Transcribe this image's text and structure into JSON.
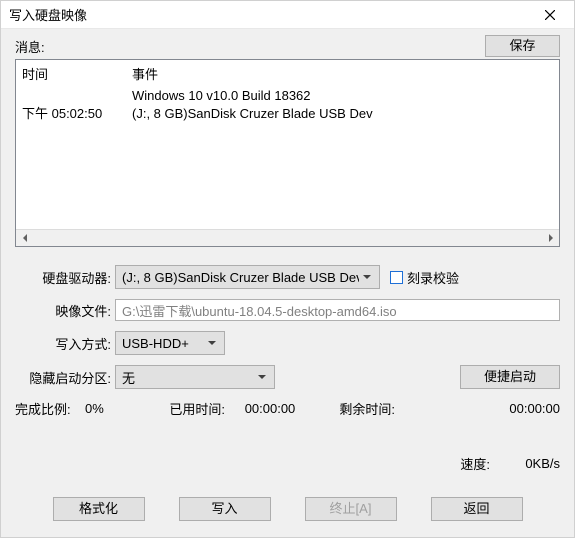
{
  "window": {
    "title": "写入硬盘映像"
  },
  "top": {
    "message_label": "消息:",
    "save_btn": "保存"
  },
  "msg": {
    "col_time": "时间",
    "col_event": "事件",
    "rows": [
      {
        "time": "",
        "event": "Windows 10 v10.0 Build 18362"
      },
      {
        "time": "下午 05:02:50",
        "event": "(J:, 8 GB)SanDisk Cruzer Blade USB Dev"
      }
    ]
  },
  "form": {
    "drive_label": "硬盘驱动器:",
    "drive_value": "(J:, 8 GB)SanDisk Cruzer Blade USB Dev",
    "verify_label": "刻录校验",
    "image_label": "映像文件:",
    "image_value": "G:\\迅雷下载\\ubuntu-18.04.5-desktop-amd64.iso",
    "write_mode_label": "写入方式:",
    "write_mode_value": "USB-HDD+",
    "hidden_label": "隐藏启动分区:",
    "hidden_value": "无",
    "quickboot_btn": "便捷启动"
  },
  "status": {
    "done_label": "完成比例:",
    "done_value": "0%",
    "elapsed_label": "已用时间:",
    "elapsed_value": "00:00:00",
    "remain_label": "剩余时间:",
    "remain_value": "00:00:00",
    "speed_label": "速度:",
    "speed_value": "0KB/s"
  },
  "buttons": {
    "format": "格式化",
    "write": "写入",
    "abort": "终止[A]",
    "back": "返回"
  }
}
